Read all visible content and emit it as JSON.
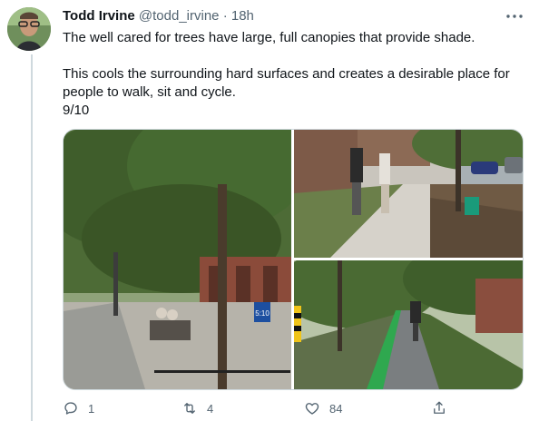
{
  "tweet": {
    "author_name": "Todd Irvine",
    "handle": "@todd_irvine",
    "separator": "·",
    "time": "18h",
    "more_icon": "ellipsis-icon",
    "paragraph_1": "The well cared for trees have large, full canopies that provide shade.",
    "paragraph_2": "This cools the surrounding hard surfaces and creates a desirable place for people to walk, sit and cycle.",
    "paragraph_3": "9/10",
    "sign_text": "5:10",
    "actions": {
      "reply_count": "1",
      "retweet_count": "4",
      "like_count": "84",
      "share_count": ""
    }
  },
  "colors": {
    "text_primary": "#0f1419",
    "text_secondary": "#536471",
    "border": "#cfd9de",
    "thread_line": "#cfd9de"
  }
}
